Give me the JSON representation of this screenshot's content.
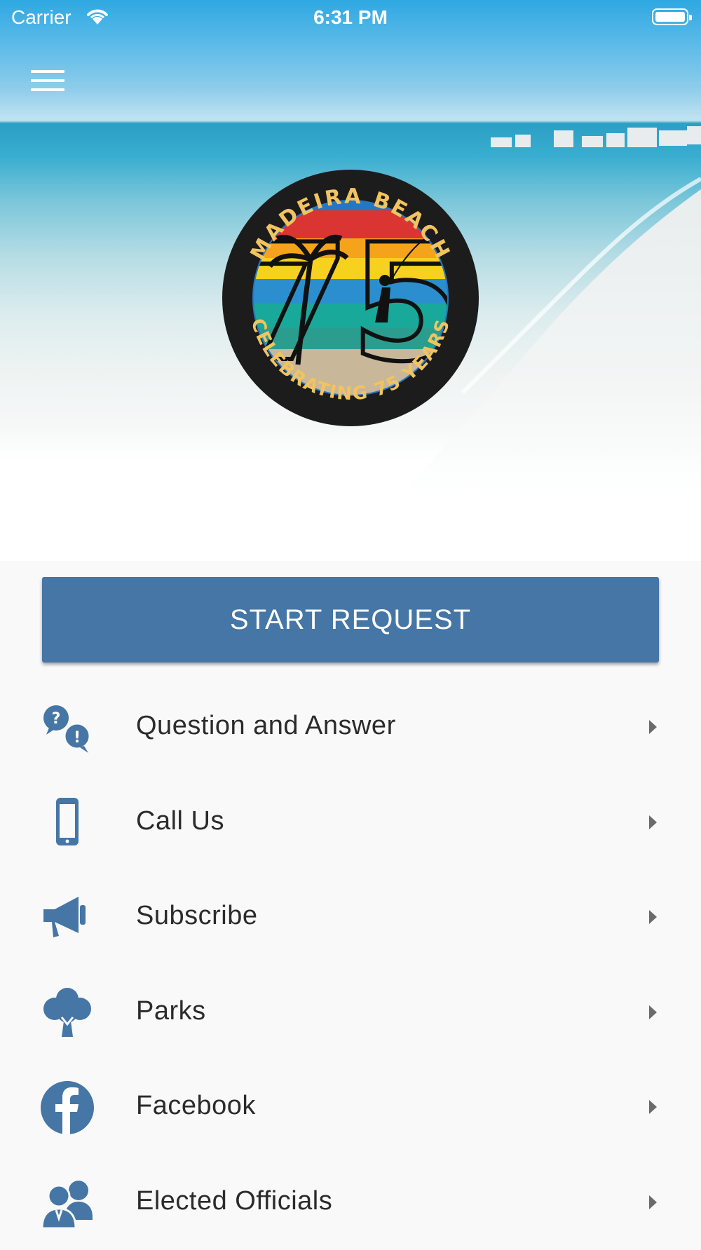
{
  "status_bar": {
    "carrier": "Carrier",
    "time": "6:31 PM"
  },
  "logo": {
    "top_text": "MADEIRA BEACH",
    "number": "75",
    "bottom_text": "CELEBRATING 75 YEARS"
  },
  "start_request": {
    "label": "START REQUEST"
  },
  "list": [
    {
      "label": "Question and Answer",
      "icon": "question-answer-icon"
    },
    {
      "label": "Call Us",
      "icon": "phone-icon"
    },
    {
      "label": "Subscribe",
      "icon": "megaphone-icon"
    },
    {
      "label": "Parks",
      "icon": "tree-icon"
    },
    {
      "label": "Facebook",
      "icon": "facebook-icon"
    },
    {
      "label": "Elected Officials",
      "icon": "people-icon"
    }
  ],
  "colors": {
    "accent": "#4576a5",
    "background": "#f9f9f9",
    "text": "#2b2b2b",
    "chevron": "#6b6b6b"
  }
}
